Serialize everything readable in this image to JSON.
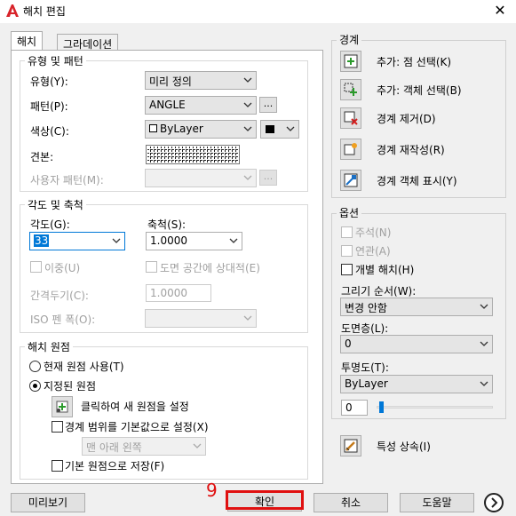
{
  "window": {
    "title": "해치 편집",
    "close_glyph": "✕"
  },
  "tabs": [
    {
      "label": "해치"
    },
    {
      "label": "그라데이션"
    }
  ],
  "type_pattern": {
    "title": "유형 및 패턴",
    "type_label": "유형(Y):",
    "type_value": "미리 정의",
    "pattern_label": "패턴(P):",
    "pattern_value": "ANGLE",
    "browse_label": "...",
    "color_label": "색상(C):",
    "color_value": "ByLayer",
    "swatch_label": "견본:",
    "custom_pattern_label": "사용자 패턴(M):",
    "custom_pattern_value": "",
    "custom_browse_label": "..."
  },
  "angle_scale": {
    "title": "각도 및 축척",
    "angle_label": "각도(G):",
    "angle_value": "33",
    "scale_label": "축척(S):",
    "scale_value": "1.0000",
    "double_label": "이중(U)",
    "paper_space_label": "도면 공간에 상대적(E)",
    "spacing_label": "간격두기(C):",
    "spacing_value": "1.0000",
    "iso_label": "ISO 펜 폭(O):",
    "iso_value": ""
  },
  "hatch_origin": {
    "title": "해치 원점",
    "current_origin_label": "현재 원점 사용(T)",
    "specified_origin_label": "지정된 원점",
    "click_set_label": "클릭하여 새 원점을 설정",
    "default_extents_label": "경계 범위를 기본값으로 설정(X)",
    "position_value": "맨 아래 왼쪽",
    "store_default_label": "기본 원점으로 저장(F)"
  },
  "boundaries": {
    "title": "경계",
    "add_pick_label": "추가: 점 선택(K)",
    "add_select_label": "추가: 객체 선택(B)",
    "remove_label": "경계 제거(D)",
    "recreate_label": "경계 재작성(R)",
    "view_label": "경계 객체 표시(Y)"
  },
  "options": {
    "title": "옵션",
    "annotative_label": "주석(N)",
    "associative_label": "연관(A)",
    "separate_label": "개별 해치(H)",
    "draw_order_label": "그리기 순서(W):",
    "draw_order_value": "변경 안함",
    "layer_label": "도면층(L):",
    "layer_value": "0",
    "transparency_label": "투명도(T):",
    "transparency_value": "ByLayer",
    "transparency_amount": "0",
    "transparency_fraction": 0.0
  },
  "inherit_label": "특성 상속(I)",
  "footer": {
    "preview_label": "미리보기",
    "ok_label": "확인",
    "cancel_label": "취소",
    "help_label": "도움말",
    "annotation_number": "9"
  },
  "colors": {
    "highlight": "#e01010",
    "selection": "#0078d7",
    "logo": "#d8232a"
  }
}
